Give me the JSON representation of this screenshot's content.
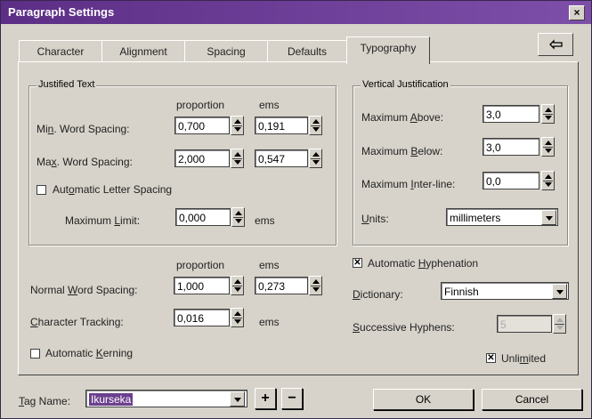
{
  "window": {
    "title": "Paragraph Settings",
    "close_glyph": "×"
  },
  "tabs": [
    {
      "label": "Character"
    },
    {
      "label": "Alignment"
    },
    {
      "label": "Spacing"
    },
    {
      "label": "Defaults"
    },
    {
      "label": "Typography"
    }
  ],
  "justified": {
    "title": "Justified Text",
    "col_proportion": "proportion",
    "col_ems": "ems",
    "min_word": {
      "label_a": "Mi",
      "label_u": "n",
      "label_b": ". Word Spacing:",
      "proportion": "0,700",
      "ems": "0,191"
    },
    "max_word": {
      "label_a": "Ma",
      "label_u": "x",
      "label_b": ". Word Spacing:",
      "proportion": "2,000",
      "ems": "0,547"
    },
    "auto_letter": {
      "label_a": "Aut",
      "label_u": "o",
      "label_b": "matic Letter Spacing",
      "checked": false
    },
    "max_limit": {
      "label_a": "Maximum ",
      "label_u": "L",
      "label_b": "imit:",
      "value": "0,000",
      "unit": "ems"
    }
  },
  "vertical": {
    "title": "Vertical Justification",
    "max_above": {
      "label_a": "Maximum ",
      "label_u": "A",
      "label_b": "bove:",
      "value": "3,0"
    },
    "max_below": {
      "label_a": "Maximum ",
      "label_u": "B",
      "label_b": "elow:",
      "value": "3,0"
    },
    "max_inter": {
      "label_a": "Maximum ",
      "label_u": "I",
      "label_b": "nter-line:",
      "value": "0,0"
    },
    "units": {
      "label_u": "U",
      "label_b": "nits:",
      "value": "millimeters"
    }
  },
  "lower": {
    "col_proportion": "proportion",
    "col_ems": "ems",
    "normal_word": {
      "label_a": "Normal ",
      "label_u": "W",
      "label_b": "ord Spacing:",
      "proportion": "1,000",
      "ems": "0,273"
    },
    "char_tracking": {
      "label_u": "C",
      "label_b": "haracter Tracking:",
      "value": "0,016",
      "unit": "ems"
    },
    "auto_kerning": {
      "label_a": "Automatic ",
      "label_u": "K",
      "label_b": "erning",
      "checked": false
    }
  },
  "hyphenation": {
    "auto": {
      "label_a": "Automatic ",
      "label_u": "H",
      "label_b": "yphenation",
      "checked": true
    },
    "dictionary": {
      "label_u": "D",
      "label_b": "ictionary:",
      "value": "Finnish"
    },
    "successive": {
      "label_u": "S",
      "label_b": "uccessive Hyphens:",
      "value": "5"
    },
    "unlimited": {
      "label_a": "Unli",
      "label_u": "m",
      "label_b": "ited",
      "checked": true
    }
  },
  "footer": {
    "tag_label_u": "T",
    "tag_label_b": "ag Name:",
    "tag_value": "Ikurseka",
    "plus": "+",
    "minus": "−",
    "ok": "OK",
    "cancel": "Cancel"
  },
  "check_glyph": "✕"
}
